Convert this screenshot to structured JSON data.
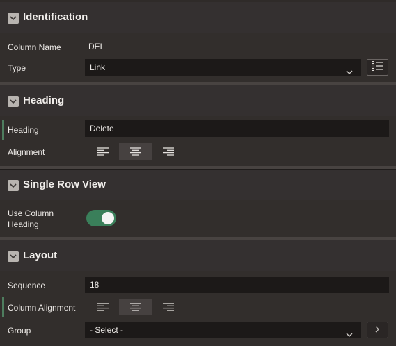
{
  "identification": {
    "title": "Identification",
    "column_name_label": "Column Name",
    "column_name_value": "DEL",
    "type_label": "Type",
    "type_value": "Link"
  },
  "heading": {
    "title": "Heading",
    "heading_label": "Heading",
    "heading_value": "Delete",
    "alignment_label": "Alignment",
    "alignment_options": [
      "left",
      "center",
      "right"
    ],
    "alignment_selected": "center"
  },
  "single_row_view": {
    "title": "Single Row View",
    "use_column_heading_label_line1": "Use Column",
    "use_column_heading_label_line2": "Heading",
    "use_column_heading_on": true
  },
  "layout": {
    "title": "Layout",
    "sequence_label": "Sequence",
    "sequence_value": "18",
    "column_alignment_label": "Column Alignment",
    "column_alignment_selected": "center",
    "group_label": "Group",
    "group_value": "- Select -"
  },
  "colors": {
    "background": "#2f2b29",
    "field_bg": "#1c1918",
    "toggle_on": "#3a7f5a",
    "required_marker": "#4e7d5e"
  },
  "icons": {
    "collapse": "chevron-down-icon",
    "list": "list-icon",
    "next": "chevron-right-icon"
  }
}
